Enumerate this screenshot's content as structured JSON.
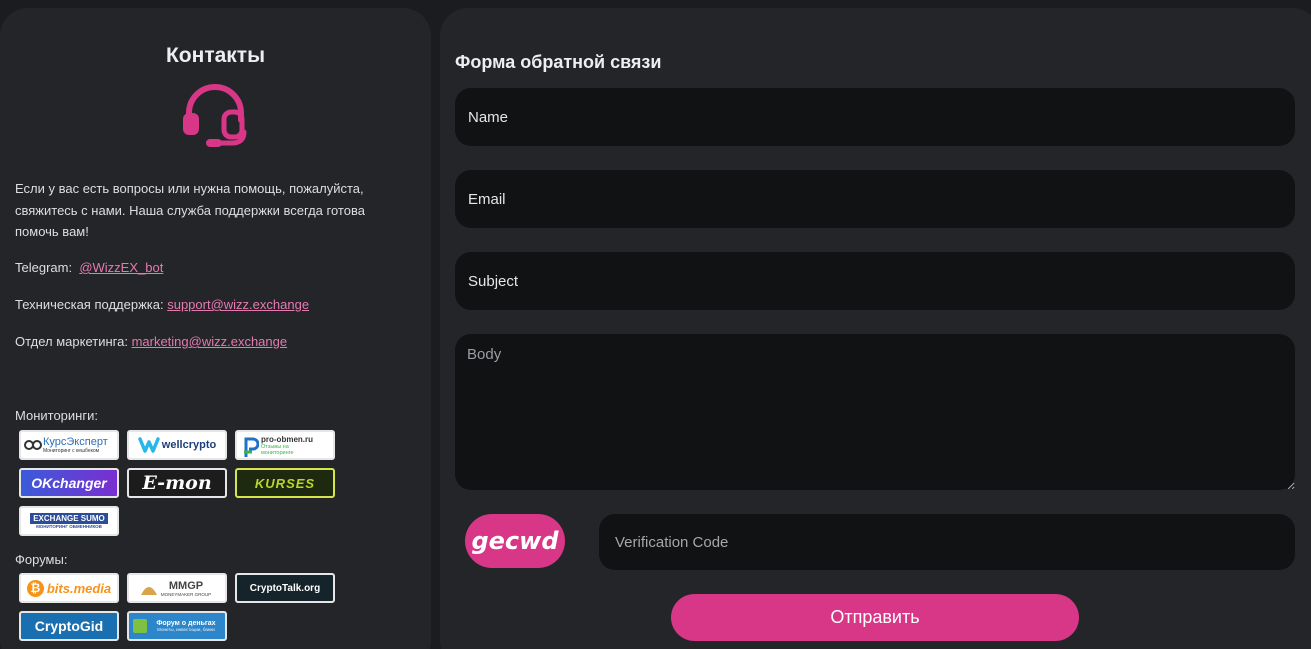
{
  "contacts": {
    "title": "Контакты",
    "intro": "Если у вас есть вопросы или нужна помощь, пожалуйста, свяжитесь с нами. Наша служба поддержки всегда готова помочь вам!",
    "telegram_label": "Telegram:",
    "telegram_link": "@WizzEX_bot",
    "support_label": "Техническая поддержка:",
    "support_link": "support@wizz.exchange",
    "marketing_label": "Отдел маркетинга:",
    "marketing_link": "marketing@wizz.exchange",
    "accent_color": "#e57ab1"
  },
  "monitorings": {
    "title": "Мониторинги:",
    "items": [
      {
        "name": "КурсЭксперт",
        "sub": "Мониторинг с кешбеком"
      },
      {
        "name": "wellcrypto"
      },
      {
        "name": "pro-obmen.ru",
        "sub": "Отзывы на мониторинге"
      },
      {
        "name": "OKchanger"
      },
      {
        "name": "E-mon"
      },
      {
        "name": "KURSES"
      },
      {
        "name": "EXCHANGE SUMO",
        "sub": "МОНИТОРИНГ ОБМЕННИКОВ"
      }
    ]
  },
  "forums": {
    "title": "Форумы:",
    "items": [
      {
        "name": "bits.media"
      },
      {
        "name": "MMGP",
        "sub": "MONEYMAKER GROUP"
      },
      {
        "name": "CryptoTalk.org"
      },
      {
        "name": "CryptoGid"
      },
      {
        "name": "Форум о деньгах",
        "sub": "Монеты, инвестиции, банки"
      }
    ]
  },
  "form": {
    "title": "Форма обратной связи",
    "name_placeholder": "Name",
    "email_placeholder": "Email",
    "subject_placeholder": "Subject",
    "body_placeholder": "Body",
    "captcha_text": "gecwd",
    "verification_placeholder": "Verification Code",
    "submit_label": "Отправить",
    "button_color": "#d83686"
  }
}
